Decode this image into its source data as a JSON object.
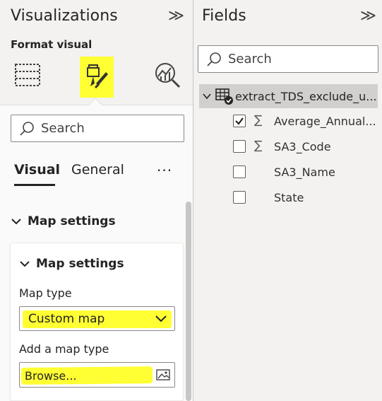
{
  "viz": {
    "title": "Visualizations",
    "collapse_glyph": "≫",
    "format_label": "Format visual",
    "icons": [
      "build-visual-icon",
      "format-visual-icon",
      "analytics-icon"
    ],
    "search_placeholder": "Search",
    "tabs": [
      {
        "label": "Visual",
        "active": true
      },
      {
        "label": "General",
        "active": false
      }
    ],
    "more_glyph": "···",
    "section": {
      "label": "Map settings",
      "card": {
        "label": "Map settings",
        "map_type_label": "Map type",
        "map_type_value": "Custom map",
        "add_map_label": "Add a map type",
        "browse_value": "Browse..."
      }
    },
    "highlight_color": "#ffff33"
  },
  "fields": {
    "title": "Fields",
    "collapse_glyph": "≫",
    "search_placeholder": "Search",
    "table": {
      "name": "extract_TDS_exclude_u...",
      "icon": "table-icon"
    },
    "items": [
      {
        "name": "Average_Annual...",
        "checked": true,
        "sigma": "∑"
      },
      {
        "name": "SA3_Code",
        "checked": false,
        "sigma": "∑"
      },
      {
        "name": "SA3_Name",
        "checked": false,
        "sigma": ""
      },
      {
        "name": "State",
        "checked": false,
        "sigma": ""
      }
    ]
  }
}
